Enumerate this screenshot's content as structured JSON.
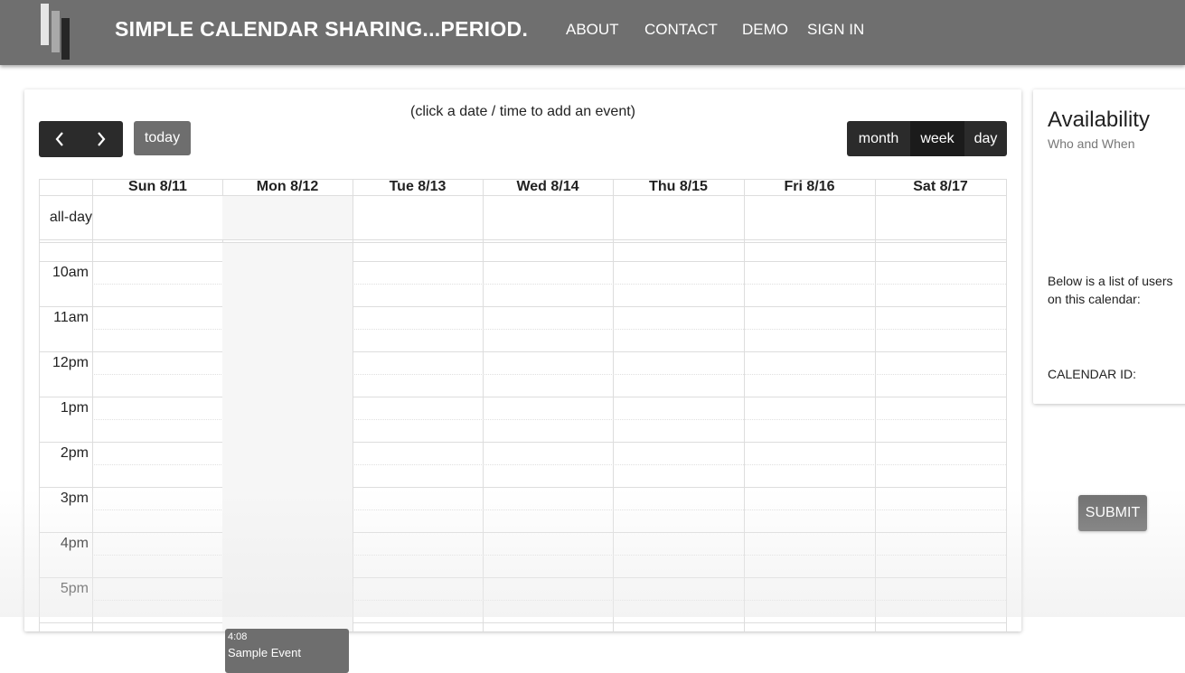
{
  "header": {
    "brand": "SIMPLE CALENDAR SHARING...PERIOD.",
    "nav": [
      "ABOUT",
      "CONTACT",
      "DEMO",
      "SIGN IN"
    ]
  },
  "calendar": {
    "hint": "(click a date / time to add an event)",
    "prev_icon": "chevron-left-icon",
    "next_icon": "chevron-right-icon",
    "today_label": "today",
    "views": [
      {
        "label": "month",
        "active": false
      },
      {
        "label": "week",
        "active": true
      },
      {
        "label": "day",
        "active": false
      }
    ],
    "days": [
      "Sun 8/11",
      "Mon 8/12",
      "Tue 8/13",
      "Wed 8/14",
      "Thu 8/15",
      "Fri 8/16",
      "Sat 8/17"
    ],
    "today_index": 1,
    "allday_label": "all-day",
    "time_labels": [
      "10am",
      "11am",
      "12pm",
      "1pm",
      "2pm",
      "3pm",
      "4pm",
      "5pm"
    ],
    "event": {
      "time": "4:08",
      "title": "Sample Event",
      "day": "Mon 8/12"
    }
  },
  "availability": {
    "title": "Availability",
    "subtitle": "Who and When",
    "users_text": "Below is a list of users on this calendar:",
    "calendar_id_label": "CALENDAR ID:"
  },
  "submit_label": "SUBMIT",
  "colors": {
    "header_bg": "#6f6f6f",
    "button_dark": "#2b2b2b",
    "button_gray": "#6e6e6e",
    "today_col": "#f6f6f6"
  }
}
